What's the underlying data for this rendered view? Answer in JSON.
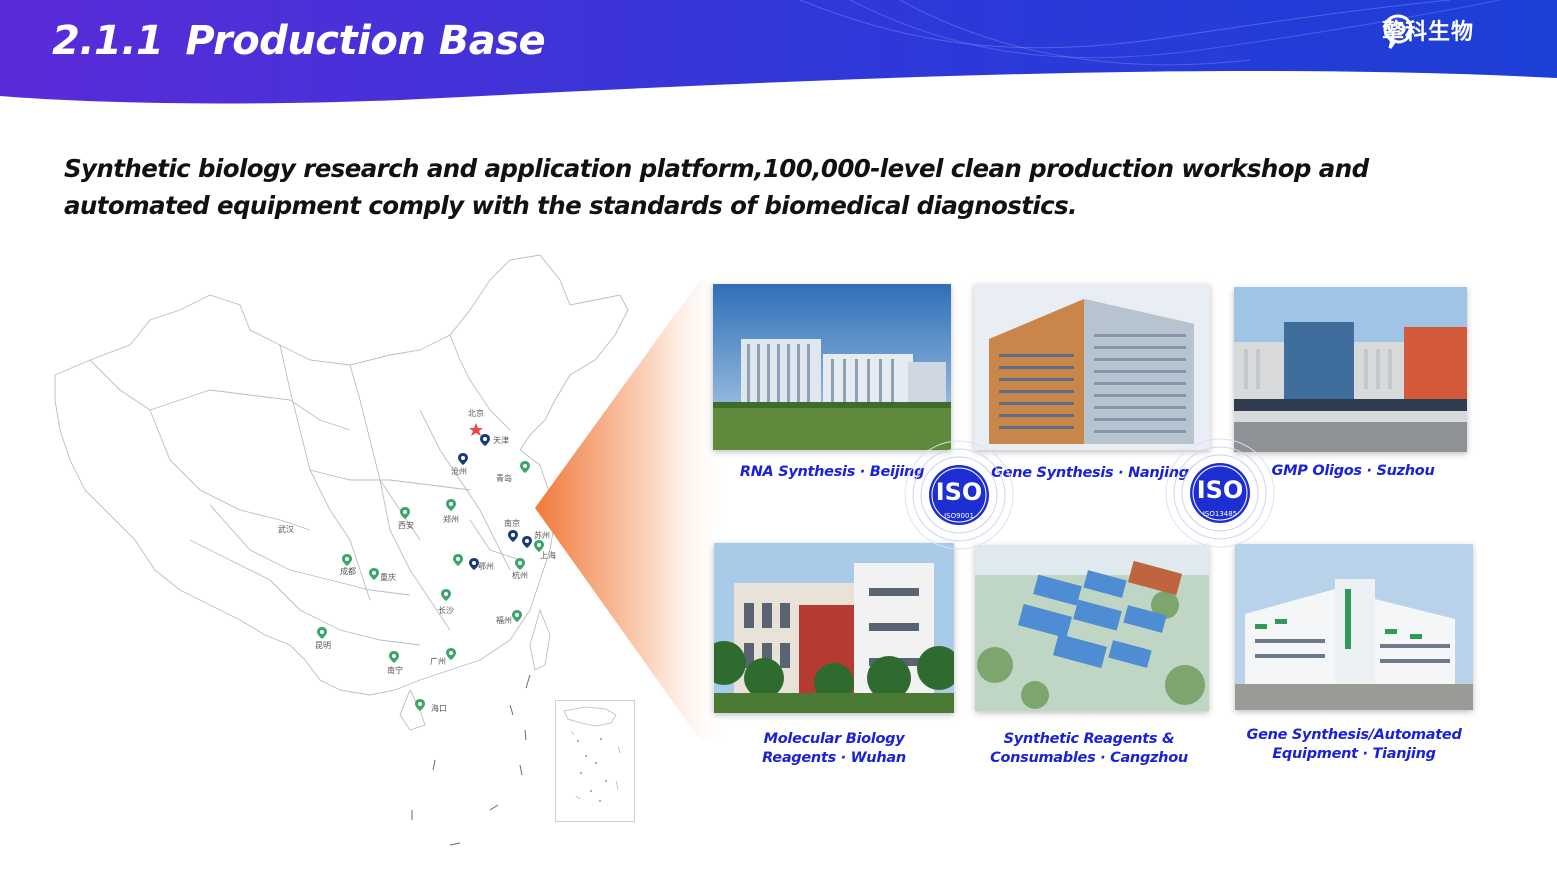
{
  "header": {
    "section_number": "2.1.1",
    "title": "Production Base",
    "logo_name": "擎科生物",
    "colors": {
      "banner_start": "#5b2bd8",
      "banner_end": "#1c3fd6"
    }
  },
  "subtitle": {
    "line1": "Synthetic biology research and application platform,100,000-level clean production workshop and",
    "line2": "automated equipment comply with the standards of biomedical diagnostics."
  },
  "map": {
    "cities": [
      {
        "label": "北京",
        "marker": "star"
      },
      {
        "label": "天津",
        "marker": "pin-dark"
      },
      {
        "label": "沧州",
        "marker": "pin-dark"
      },
      {
        "label": "青岛",
        "marker": "pin-green"
      },
      {
        "label": "西安",
        "marker": "pin-green"
      },
      {
        "label": "郑州",
        "marker": "pin-green"
      },
      {
        "label": "南京",
        "marker": "pin-dark"
      },
      {
        "label": "苏州",
        "marker": "pin-dark"
      },
      {
        "label": "上海",
        "marker": "pin-green"
      },
      {
        "label": "武汉",
        "marker": "none"
      },
      {
        "label": "成都",
        "marker": "pin-green"
      },
      {
        "label": "重庆",
        "marker": "pin-green"
      },
      {
        "label": "鄂州",
        "marker": "pin-dark"
      },
      {
        "label": "杭州",
        "marker": "pin-green"
      },
      {
        "label": "长沙",
        "marker": "pin-green"
      },
      {
        "label": "福州",
        "marker": "pin-green"
      },
      {
        "label": "昆明",
        "marker": "pin-green"
      },
      {
        "label": "南宁",
        "marker": "pin-green"
      },
      {
        "label": "广州",
        "marker": "pin-green"
      },
      {
        "label": "海口",
        "marker": "pin-green"
      }
    ]
  },
  "facilities": [
    {
      "caption": "RNA Synthesis · Beijing"
    },
    {
      "caption": "Gene Synthesis · Nanjing"
    },
    {
      "caption": "GMP Oligos · Suzhou"
    },
    {
      "caption_line1": "Molecular Biology",
      "caption_line2": "Reagents · Wuhan"
    },
    {
      "caption_line1": "Synthetic Reagents &",
      "caption_line2": "Consumables · Cangzhou"
    },
    {
      "caption_line1": "Gene Synthesis/Automated",
      "caption_line2": "Equipment · Tianjing"
    }
  ],
  "certifications": [
    {
      "mark": "ISO",
      "standard": "ISO9001"
    },
    {
      "mark": "ISO",
      "standard": "ISO13485"
    }
  ]
}
